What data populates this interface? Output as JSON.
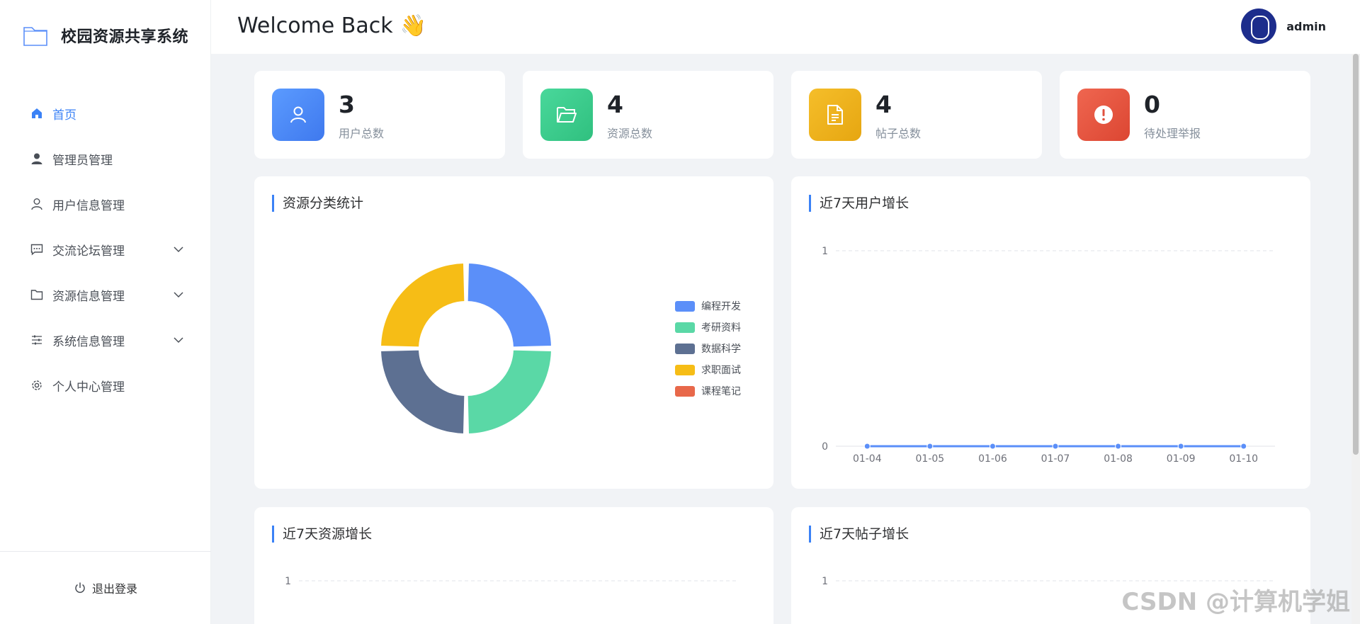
{
  "app": {
    "title": "校园资源共享系统"
  },
  "header": {
    "welcome": "Welcome Back",
    "wave": "👋",
    "username": "admin"
  },
  "sidebar": {
    "items": [
      {
        "label": "首页",
        "active": true,
        "icon": "home-icon",
        "has_submenu": false
      },
      {
        "label": "管理员管理",
        "active": false,
        "icon": "user-solid-icon",
        "has_submenu": false
      },
      {
        "label": "用户信息管理",
        "active": false,
        "icon": "user-outline-icon",
        "has_submenu": false
      },
      {
        "label": "交流论坛管理",
        "active": false,
        "icon": "chat-icon",
        "has_submenu": true
      },
      {
        "label": "资源信息管理",
        "active": false,
        "icon": "folder-icon",
        "has_submenu": true
      },
      {
        "label": "系统信息管理",
        "active": false,
        "icon": "sliders-icon",
        "has_submenu": true
      },
      {
        "label": "个人中心管理",
        "active": false,
        "icon": "gear-icon",
        "has_submenu": false
      }
    ],
    "logout": "退出登录"
  },
  "stats": [
    {
      "value": "3",
      "label": "用户总数",
      "icon": "user-icon",
      "color": "#4f8ef7"
    },
    {
      "value": "4",
      "label": "资源总数",
      "icon": "folder-open-icon",
      "color": "#3ccf91"
    },
    {
      "value": "4",
      "label": "帖子总数",
      "icon": "document-icon",
      "color": "#f0b21a"
    },
    {
      "value": "0",
      "label": "待处理举报",
      "icon": "alert-icon",
      "color": "#e8543f"
    }
  ],
  "panels": {
    "category": {
      "title": "资源分类统计"
    },
    "users7": {
      "title": "近7天用户增长"
    },
    "resources7": {
      "title": "近7天资源增长"
    },
    "posts7": {
      "title": "近7天帖子增长"
    }
  },
  "chart_data": [
    {
      "type": "pie",
      "title": "资源分类统计",
      "categories": [
        "编程开发",
        "考研资料",
        "数据科学",
        "求职面试",
        "课程笔记"
      ],
      "values": [
        1,
        1,
        1,
        1,
        0
      ],
      "colors": [
        "#5b8ff9",
        "#5ad8a6",
        "#5d7092",
        "#f6bd16",
        "#e8684a"
      ],
      "legend": "right"
    },
    {
      "type": "line",
      "title": "近7天用户增长",
      "x": [
        "01-04",
        "01-05",
        "01-06",
        "01-07",
        "01-08",
        "01-09",
        "01-10"
      ],
      "series": [
        {
          "values": [
            0,
            0,
            0,
            0,
            0,
            0,
            0
          ]
        }
      ],
      "yticks": [
        "0",
        "1"
      ],
      "ylim": [
        0,
        1
      ],
      "color": "#5b8ff9"
    },
    {
      "type": "line",
      "title": "近7天资源增长",
      "yticks": [
        "1"
      ],
      "ylim": [
        0,
        1
      ]
    },
    {
      "type": "line",
      "title": "近7天帖子增长",
      "yticks": [
        "1"
      ],
      "ylim": [
        0,
        1
      ]
    }
  ],
  "watermark": "CSDN @计算机学姐"
}
